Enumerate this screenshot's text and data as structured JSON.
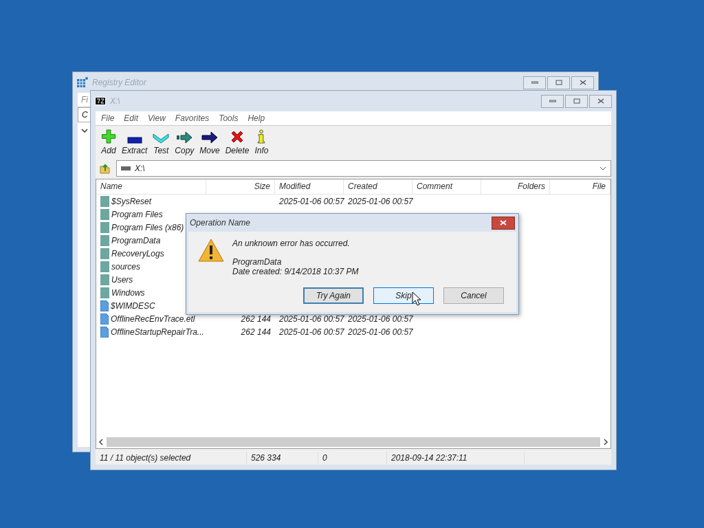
{
  "background_window": {
    "title": "Registry Editor",
    "menu": [
      "Fi"
    ],
    "header": "C"
  },
  "archive_window": {
    "title": "X:\\",
    "menu": [
      "File",
      "Edit",
      "View",
      "Favorites",
      "Tools",
      "Help"
    ],
    "toolbar": [
      {
        "kind": "add",
        "label": "Add"
      },
      {
        "kind": "extract",
        "label": "Extract"
      },
      {
        "kind": "test",
        "label": "Test"
      },
      {
        "kind": "copy",
        "label": "Copy"
      },
      {
        "kind": "move",
        "label": "Move"
      },
      {
        "kind": "delete",
        "label": "Delete"
      },
      {
        "kind": "info",
        "label": "Info"
      }
    ],
    "address": "X:\\",
    "columns": [
      "Name",
      "Size",
      "Modified",
      "Created",
      "Comment",
      "Folders",
      "File"
    ],
    "rows": [
      {
        "kind": "folder",
        "name": "$SysReset",
        "modified": "2025-01-06 00:57",
        "created": "2025-01-06 00:57"
      },
      {
        "kind": "folder",
        "name": "Program Files"
      },
      {
        "kind": "folder",
        "name": "Program Files (x86)"
      },
      {
        "kind": "folder",
        "name": "ProgramData"
      },
      {
        "kind": "folder",
        "name": "RecoveryLogs"
      },
      {
        "kind": "folder",
        "name": "sources"
      },
      {
        "kind": "folder",
        "name": "Users"
      },
      {
        "kind": "folder",
        "name": "Windows"
      },
      {
        "kind": "file",
        "name": "$WIMDESC"
      },
      {
        "kind": "file",
        "name": "OfflineRecEnvTrace.etl",
        "size": "262 144",
        "modified": "2025-01-06 00:57",
        "created": "2025-01-06 00:57"
      },
      {
        "kind": "file",
        "name": "OfflineStartupRepairTra...",
        "size": "262 144",
        "modified": "2025-01-06 00:57",
        "created": "2025-01-06 00:57"
      }
    ],
    "status_bar": [
      "11 / 11 object(s) selected",
      "526 334",
      "0",
      "2018-09-14 22:37:11"
    ]
  },
  "dialog": {
    "title": "Operation Name",
    "message": "An unknown error has occurred.",
    "item": "ProgramData",
    "detail": "Date created: 9/14/2018 10:37 PM",
    "buttons": [
      {
        "label": "Try Again",
        "default": true,
        "hovered": false
      },
      {
        "label": "Skip",
        "default": false,
        "hovered": true
      },
      {
        "label": "Cancel",
        "default": false,
        "hovered": false
      }
    ]
  }
}
